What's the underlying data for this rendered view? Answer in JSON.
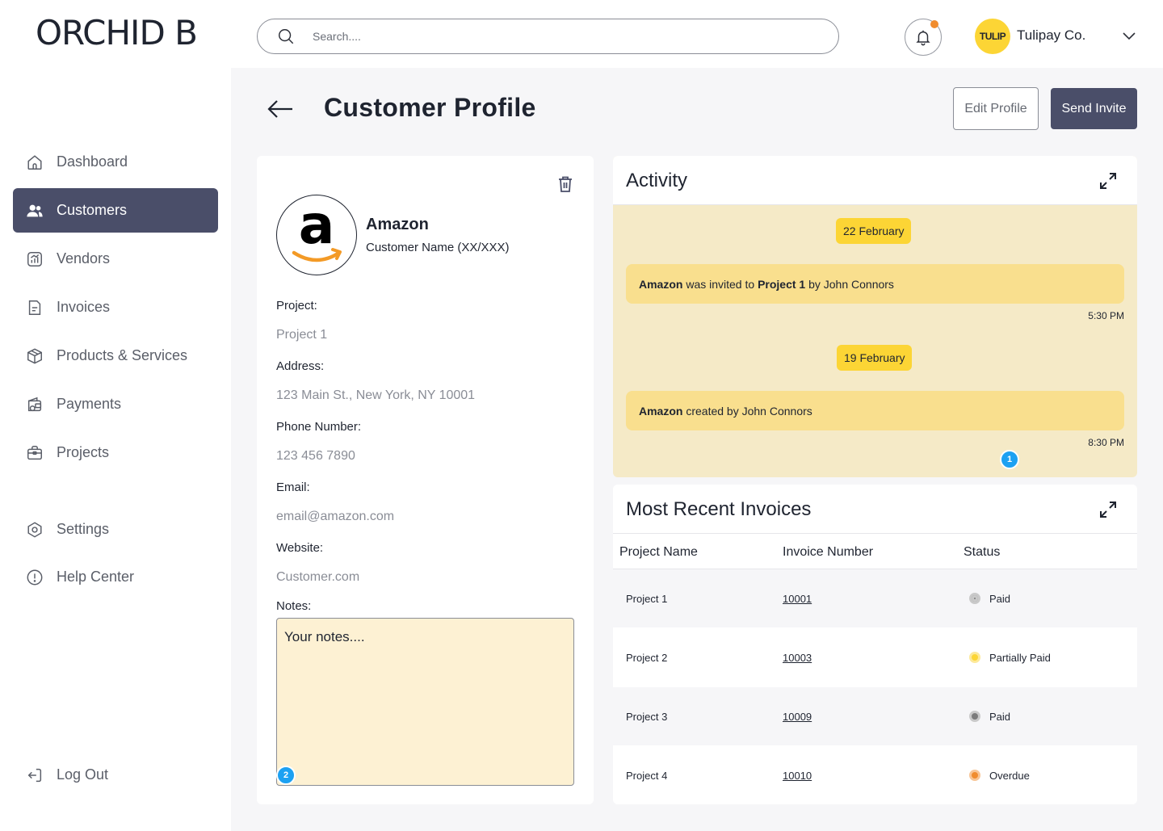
{
  "header": {
    "logo": "ORCHID B",
    "search_placeholder": "Search....",
    "avatar_text": "TULIP",
    "company_name": "Tulipay Co."
  },
  "sidebar": {
    "items": [
      {
        "label": "Dashboard",
        "icon": "home-icon",
        "active": false
      },
      {
        "label": "Customers",
        "icon": "users-icon",
        "active": true
      },
      {
        "label": "Vendors",
        "icon": "chart-icon",
        "active": false
      },
      {
        "label": "Invoices",
        "icon": "document-icon",
        "active": false
      },
      {
        "label": "Products & Services",
        "icon": "box-icon",
        "active": false
      },
      {
        "label": "Payments",
        "icon": "wallet-icon",
        "active": false
      },
      {
        "label": "Projects",
        "icon": "briefcase-icon",
        "active": false
      },
      {
        "label": "Settings",
        "icon": "settings-icon",
        "active": false
      },
      {
        "label": "Help Center",
        "icon": "help-icon",
        "active": false
      }
    ],
    "logout": "Log Out"
  },
  "page": {
    "title": "Customer Profile",
    "edit_button": "Edit Profile",
    "send_button": "Send Invite"
  },
  "profile": {
    "name": "Amazon",
    "subtitle": "Customer Name (XX/XXX)",
    "fields": [
      {
        "label": "Project:",
        "value": "Project 1"
      },
      {
        "label": "Address:",
        "value": "123 Main St., New York, NY 10001"
      },
      {
        "label": "Phone Number:",
        "value": "123 456 7890"
      },
      {
        "label": "Email:",
        "value": "email@amazon.com"
      },
      {
        "label": "Website:",
        "value": "Customer.com"
      }
    ],
    "notes_label": "Notes:",
    "notes_placeholder": "Your notes....",
    "notes_badge": "2"
  },
  "activity": {
    "title": "Activity",
    "entries": [
      {
        "date": "22 February",
        "actor": "Amazon",
        "text_a": " was invited to ",
        "target": "Project 1",
        "text_b": " by John Connors",
        "time": "5:30 PM"
      },
      {
        "date": "19 February",
        "actor": "Amazon",
        "text_a": " created by John Connors",
        "target": "",
        "text_b": "",
        "time": "8:30 PM"
      }
    ],
    "badge": "1"
  },
  "invoices": {
    "title": "Most Recent Invoices",
    "columns": [
      "Project Name",
      "Invoice Number",
      "Status"
    ],
    "rows": [
      {
        "project": "Project 1",
        "number": "10001",
        "status": "Paid",
        "color": "#7b7b7b",
        "ring": "#c9c9c9"
      },
      {
        "project": "Project 2",
        "number": "10003",
        "status": "Partially Paid",
        "color": "#fcd535",
        "ring": "#fde99a"
      },
      {
        "project": "Project 3",
        "number": "10009",
        "status": "Paid",
        "color": "#7b7b7b",
        "ring": "#c9c9c9"
      },
      {
        "project": "Project 4",
        "number": "10010",
        "status": "Overdue",
        "color": "#f08c2e",
        "ring": "#f8c595"
      }
    ]
  },
  "colors": {
    "accent": "#4a4e69",
    "yellow": "#fcd535",
    "activity_bg": "#f5eac7",
    "badge_blue": "#1da1f2"
  }
}
